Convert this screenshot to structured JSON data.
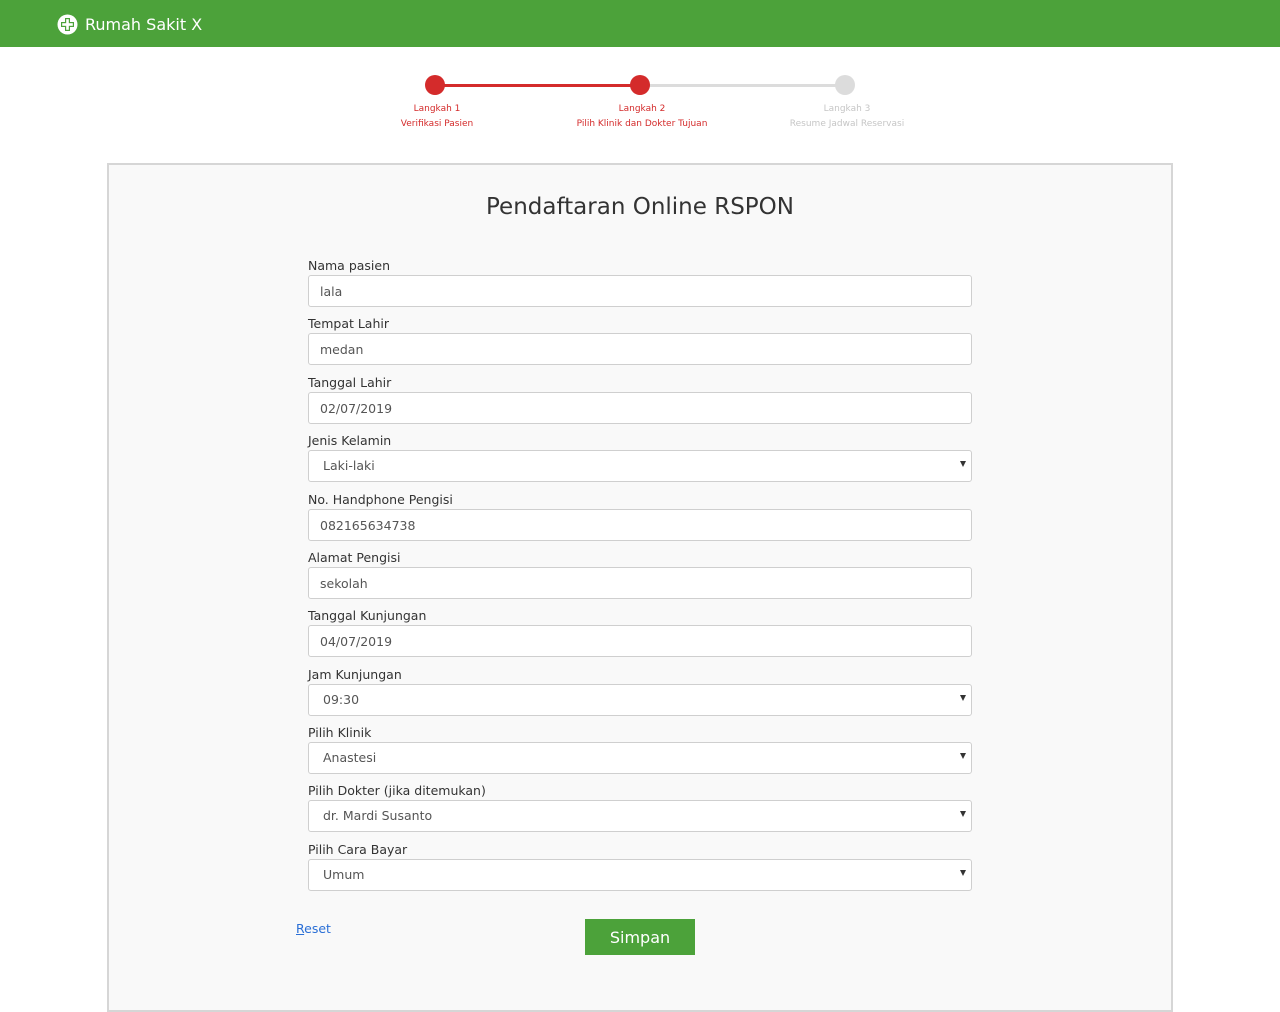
{
  "navbar": {
    "brand": "Rumah Sakit X",
    "colors": {
      "background": "#4ca23a",
      "text": "#ffffff"
    }
  },
  "stepper": {
    "active_color": "#d42b2b",
    "inactive_color": "#dcdcdc",
    "steps": [
      {
        "title": "Langkah 1",
        "subtitle": "Verifikasi Pasien",
        "status": "completed"
      },
      {
        "title": "Langkah 2",
        "subtitle": "Pilih Klinik dan Dokter Tujuan",
        "status": "current"
      },
      {
        "title": "Langkah 3",
        "subtitle": "Resume Jadwal Reservasi",
        "status": "upcoming"
      }
    ]
  },
  "form": {
    "title": "Pendaftaran Online RSPON",
    "fields": [
      {
        "label": "Nama pasien",
        "type": "text",
        "value": "lala"
      },
      {
        "label": "Tempat Lahir",
        "type": "text",
        "value": "medan"
      },
      {
        "label": "Tanggal Lahir",
        "type": "text",
        "value": "02/07/2019"
      },
      {
        "label": "Jenis Kelamin",
        "type": "select",
        "value": "Laki-laki"
      },
      {
        "label": "No. Handphone Pengisi",
        "type": "text",
        "value": "082165634738"
      },
      {
        "label": "Alamat Pengisi",
        "type": "text",
        "value": "sekolah"
      },
      {
        "label": "Tanggal Kunjungan",
        "type": "text",
        "value": "04/07/2019"
      },
      {
        "label": "Jam Kunjungan",
        "type": "select",
        "value": "09:30"
      },
      {
        "label": "Pilih Klinik",
        "type": "select",
        "value": "Anastesi"
      },
      {
        "label": "Pilih Dokter (jika ditemukan)",
        "type": "select",
        "value": "dr. Mardi Susanto"
      },
      {
        "label": "Pilih Cara Bayar",
        "type": "select",
        "value": "Umum"
      }
    ],
    "reset_first_letter": "R",
    "reset_rest": "eset",
    "submit_label": "Simpan",
    "colors": {
      "submit": "#4ca23a",
      "link": "#2a6fd6"
    }
  }
}
